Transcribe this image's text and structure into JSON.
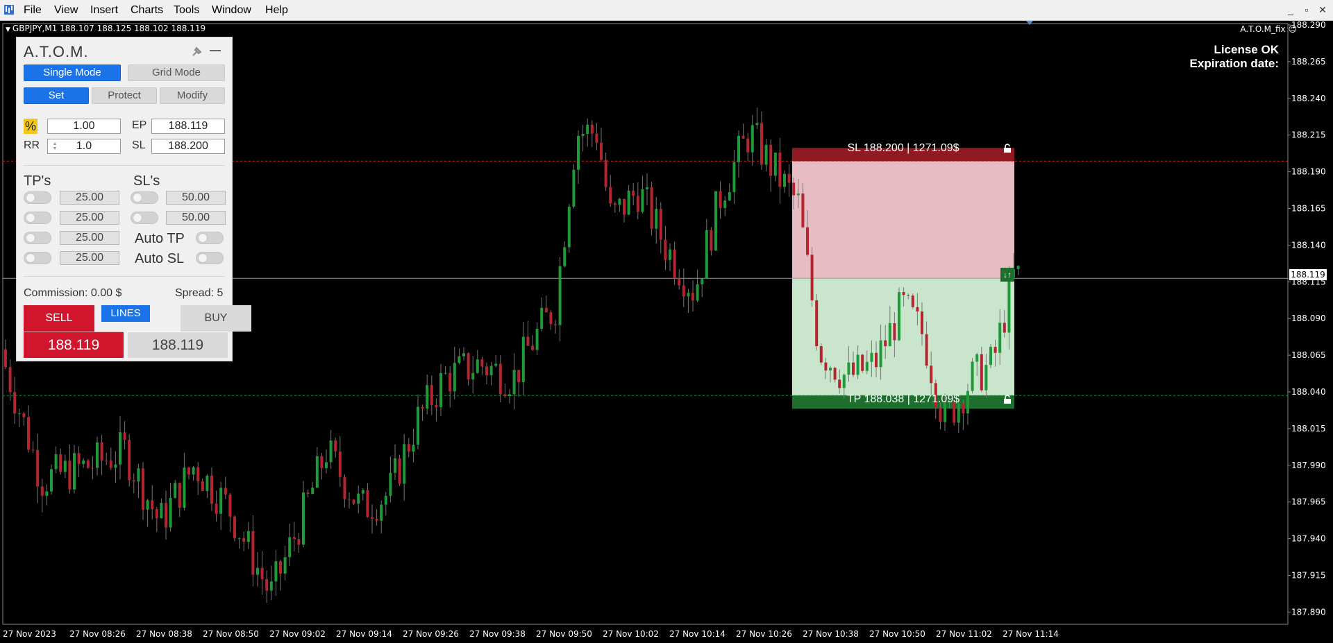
{
  "menu": {
    "items": [
      "File",
      "View",
      "Insert",
      "Charts",
      "Tools",
      "Window",
      "Help"
    ]
  },
  "window_controls": [
    "_",
    "▫",
    "✕"
  ],
  "chart": {
    "symbol_line": "GBPJPY,M1  188.107 188.125 188.102 188.119",
    "ea_name": "A.T.O.M_fix",
    "license_line1": "License OK",
    "license_line2": "Expiration date:",
    "price_axis": [
      "188.290",
      "188.265",
      "188.240",
      "188.215",
      "188.190",
      "188.165",
      "188.140",
      "188.115",
      "188.090",
      "188.065",
      "188.040",
      "188.015",
      "187.990",
      "187.965",
      "187.940",
      "187.915",
      "187.890"
    ],
    "current_price": "188.119",
    "time_axis": [
      "27 Nov 2023",
      "27 Nov 08:26",
      "27 Nov 08:38",
      "27 Nov 08:50",
      "27 Nov 09:02",
      "27 Nov 09:14",
      "27 Nov 09:26",
      "27 Nov 09:38",
      "27 Nov 09:50",
      "27 Nov 10:02",
      "27 Nov 10:14",
      "27 Nov 10:26",
      "27 Nov 10:38",
      "27 Nov 10:50",
      "27 Nov 11:02",
      "27 Nov 11:14"
    ],
    "sl_label": "SL 188.200 | 1271.09$",
    "tp_label": "TP 188.038 | 1271.09$",
    "swap_symbol": "↓↑",
    "colors": {
      "bull": "#1f9a3a",
      "bear": "#b5252f",
      "sl_zone": "#e7bcc3",
      "tp_zone": "#c9e6cc",
      "sl_bar": "#8f1a22",
      "tp_bar": "#1e6e2e"
    },
    "y_min": 187.88,
    "y_max": 188.295,
    "sl_price": 188.2,
    "tp_price": 188.038,
    "ep_price": 188.119
  },
  "panel": {
    "title": "A.T.O.M.",
    "mode_single": "Single Mode",
    "mode_grid": "Grid Mode",
    "tab_set": "Set",
    "tab_protect": "Protect",
    "tab_modify": "Modify",
    "risk_icon": "%",
    "risk_value": "1.00",
    "ep_label": "EP",
    "ep_value": "188.119",
    "rr_label": "RR",
    "rr_value": "1.0",
    "sl_label": "SL",
    "sl_value": "188.200",
    "tps_label": "TP's",
    "sls_label": "SL's",
    "tp_values": [
      "25.00",
      "25.00",
      "25.00",
      "25.00"
    ],
    "sl_values": [
      "50.00",
      "50.00"
    ],
    "auto_tp": "Auto TP",
    "auto_sl": "Auto SL",
    "commission": "Commission: 0.00 $",
    "spread": "Spread: 5",
    "sell_label": "SELL",
    "lines_label": "LINES",
    "buy_label": "BUY",
    "sell_price": "188.119",
    "buy_price": "188.119"
  }
}
